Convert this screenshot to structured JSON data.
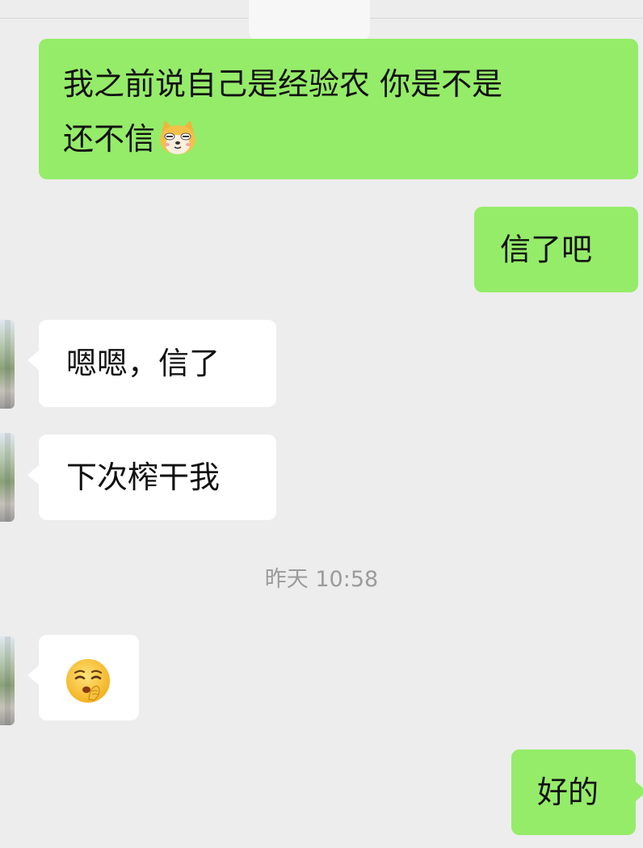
{
  "messages": [
    {
      "side": "right",
      "text_line1": "我之前说自己是经验农 你是不是",
      "text_line2": "还不信",
      "emoji_icon": "doge-icon"
    },
    {
      "side": "right",
      "text": "信了吧"
    },
    {
      "side": "left",
      "text": "嗯嗯，信了"
    },
    {
      "side": "left",
      "text": "下次榨干我"
    },
    {
      "side": "left",
      "emoji_icon": "shushing-face-icon"
    },
    {
      "side": "right",
      "text": "好的"
    }
  ],
  "timestamp": "昨天 10:58",
  "colors": {
    "background": "#ededed",
    "outgoing_bubble": "#95ec69",
    "incoming_bubble": "#ffffff",
    "timestamp_text": "#9b9b9b"
  }
}
